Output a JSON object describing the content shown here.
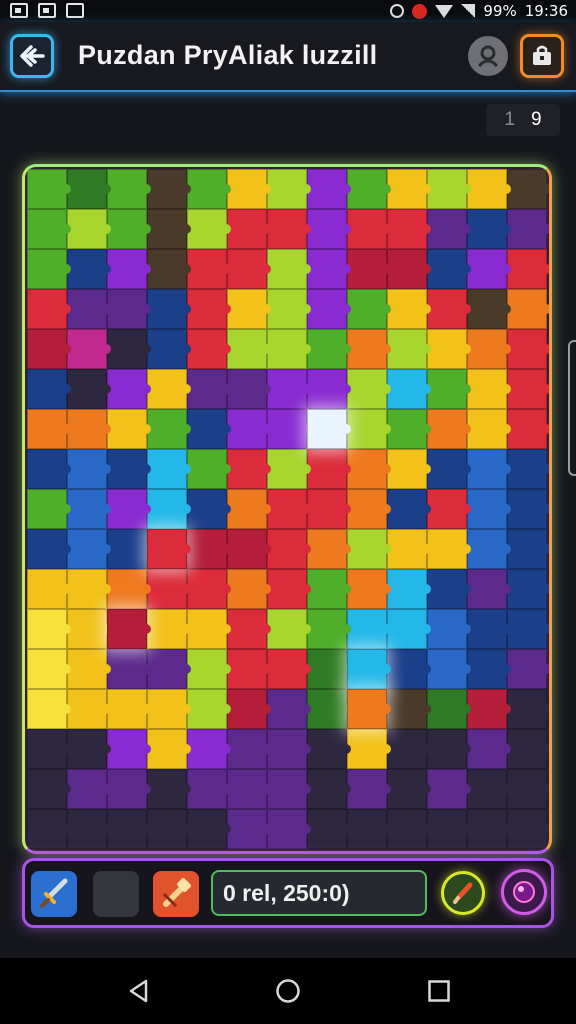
{
  "status_bar": {
    "battery": "99%",
    "time": "19:36"
  },
  "header": {
    "title": "Puzdan PryAliak luzzill",
    "back_icon": "back-arrow-icon",
    "profile_icon": "profile-icon",
    "shop_icon": "shop-bag-icon"
  },
  "counter": {
    "placed": "1",
    "total": "9"
  },
  "toolbar": {
    "score_text": "0 rel, 250:0)",
    "tools": [
      "sword-icon",
      "empty-slot-icon",
      "hammer-icon",
      "brush-icon",
      "orb-icon"
    ]
  },
  "colors": {
    "accent_blue": "#3bb8f0",
    "accent_orange": "#f08a2c",
    "accent_purple": "#a856e0"
  },
  "board": {
    "columns": 13,
    "rows": 17,
    "palette": {
      "g": "#4fae2a",
      "G": "#2f7a24",
      "l": "#a8d62e",
      "y": "#f2c21a",
      "Y": "#f7e23a",
      "o": "#ee7a1f",
      "r": "#dc2b3a",
      "R": "#b51e3a",
      "p": "#8a2bd1",
      "P": "#5c2a8c",
      "b": "#2a68c8",
      "B": "#1c3f8a",
      "c": "#23b8e8",
      "w": "#e9f4ff",
      "d": "#2e2740",
      "m": "#c2298f",
      "n": "#4a3a2a"
    },
    "layout": [
      "gGgngylpgylyn",
      "glgnlrrprrPBP",
      "gBpnrrlpRRBpr",
      "rPPBrylpgyrno",
      "RmdBrllgolyor",
      "BdpyPPpplcgyr",
      "ooygBppwlgoyr",
      "BbBcgrlroyBbB",
      "gbpcBorroBrbB",
      "BbBrRRrolyybB",
      "yyorrorgocBPB",
      "YyRyyrlgccbBB",
      "YyPPlrrGcBbBP",
      "YyyylRPGonGRd",
      "ddpypPPdyddPd",
      "dPPdPPPdPdPdd",
      "dddddPPdddddd"
    ],
    "glow_cells": [
      [
        6,
        7
      ],
      [
        11,
        2
      ],
      [
        12,
        8
      ],
      [
        9,
        3
      ],
      [
        13,
        8
      ]
    ]
  }
}
